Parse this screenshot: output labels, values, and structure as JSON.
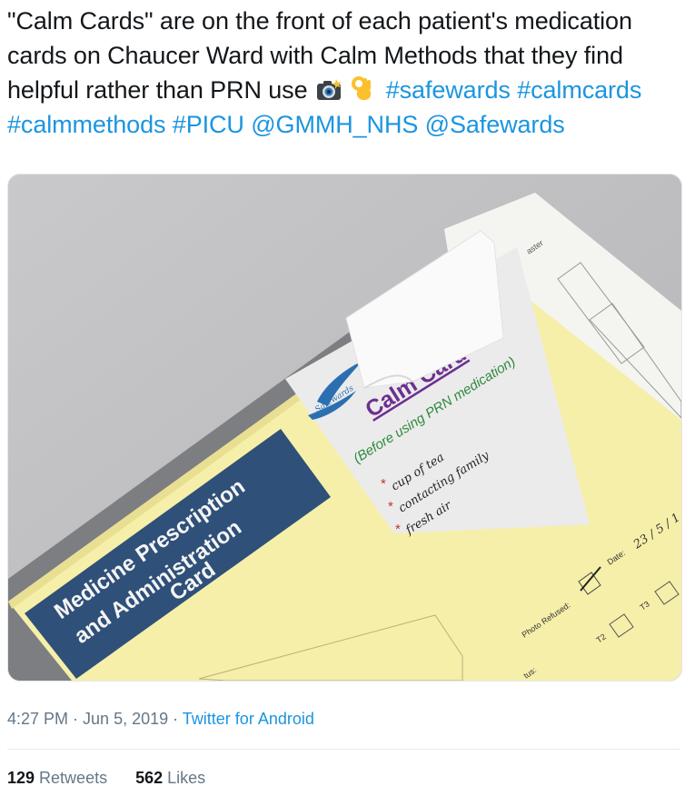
{
  "tweet": {
    "text_plain": "\"Calm Cards\" are on the front of each patient's medication cards on Chaucer Ward with Calm Methods that they find helpful rather than PRN use",
    "emojis": [
      "camera-flash-emoji",
      "ok-hand-emoji"
    ],
    "hashtags": [
      "#safewards",
      "#calmcards",
      "#calmmethods",
      "#PICU"
    ],
    "mentions": [
      "@GMMH_NHS",
      "@Safewards"
    ],
    "link_color": "#1b95e0"
  },
  "photo": {
    "calm_card_title": "Calm Card",
    "calm_card_subtitle": "(Before using PRN medication)",
    "calm_card_logo_text": "Safewards",
    "calm_card_items": [
      "cup of tea",
      "contacting family",
      "fresh air"
    ],
    "prescription_card_title_line1": "Medicine Prescription",
    "prescription_card_title_line2": "and Administration",
    "prescription_card_title_line3": "Card",
    "form_photo_refused": "Photo Refused:",
    "form_date": "Date:",
    "form_date_value": "23 / 5 / 1",
    "form_t2": "T2",
    "form_t3": "T3",
    "form_status_fragment": "tus:",
    "form_corner_fragment": "aster"
  },
  "meta": {
    "time": "4:27 PM",
    "separator1": " · ",
    "date": "Jun 5, 2019",
    "separator2": " · ",
    "source": "Twitter for Android"
  },
  "stats": {
    "retweets_count": "129",
    "retweets_label": " Retweets",
    "likes_count": "562",
    "likes_label": " Likes"
  }
}
